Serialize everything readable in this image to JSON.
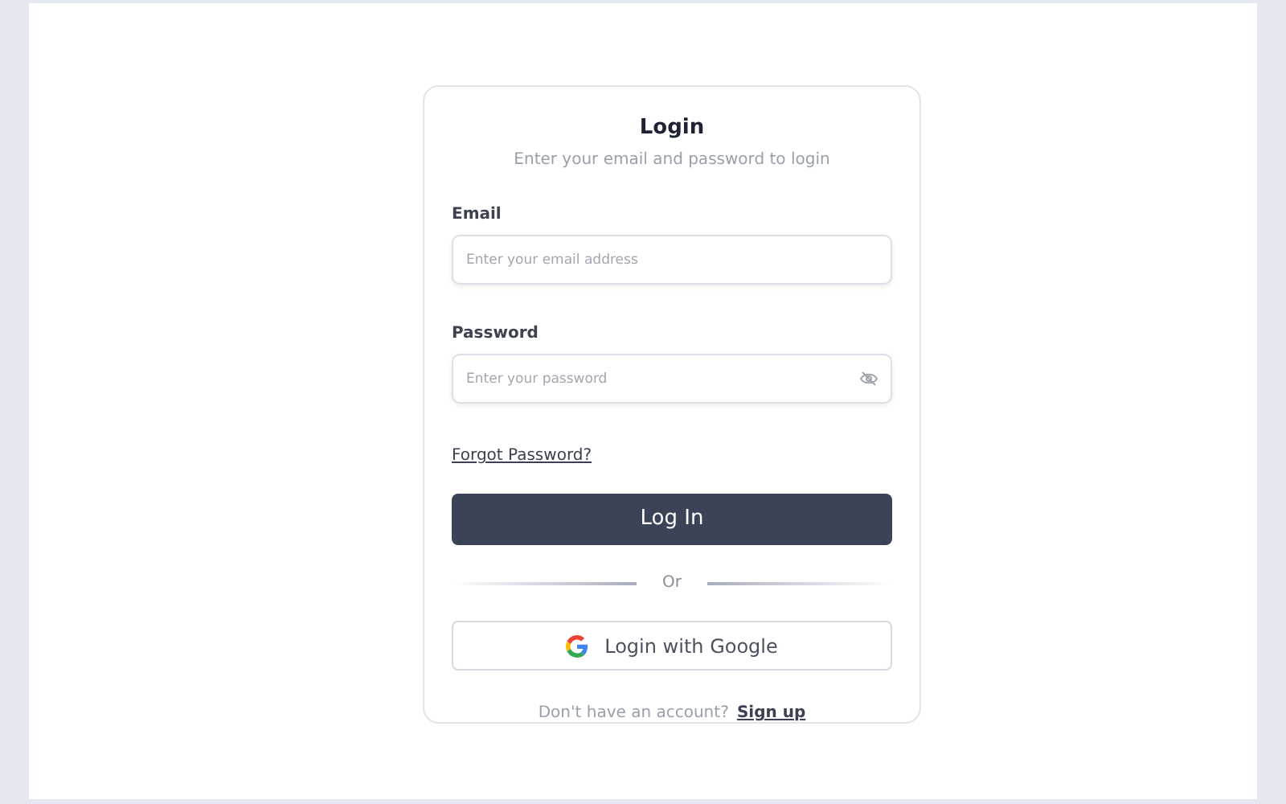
{
  "card": {
    "title": "Login",
    "subtitle": "Enter your email and password to login"
  },
  "fields": [
    {
      "kind": "email",
      "label": "Email",
      "placeholder": "Enter your email address"
    },
    {
      "kind": "password",
      "label": "Password",
      "placeholder": "Enter your password"
    }
  ],
  "forgot_link": "Forgot Password?",
  "login_button": "Log In",
  "divider": "Or",
  "google_button": "Login with Google",
  "footer": {
    "text": "Don't have an account?",
    "link": "Sign up"
  }
}
